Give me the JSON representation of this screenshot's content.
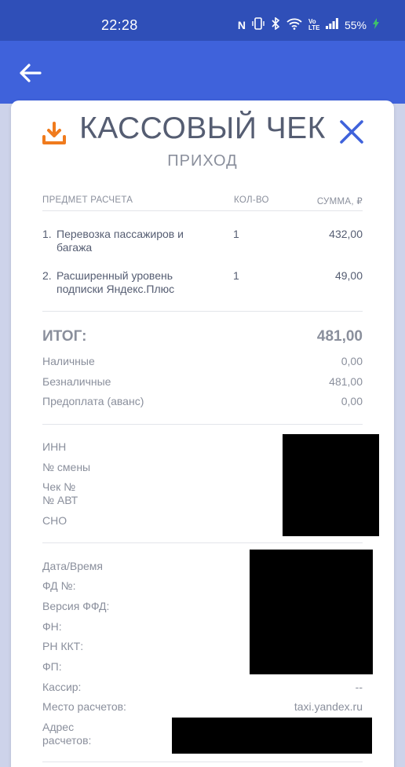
{
  "status_bar": {
    "time": "22:28",
    "battery": "55%",
    "network_label": "Vo LTE"
  },
  "receipt": {
    "title": "КАССОВЫЙ ЧЕК",
    "subtitle": "ПРИХОД",
    "columns": {
      "item": "ПРЕДМЕТ РАСЧЕТА",
      "qty": "КОЛ-ВО",
      "sum": "СУММА, ₽"
    },
    "items": [
      {
        "num": "1.",
        "name": "Перевозка пассажиров и багажа",
        "qty": "1",
        "sum": "432,00"
      },
      {
        "num": "2.",
        "name": "Расширенный уровень подписки Яндекс.Плюс",
        "qty": "1",
        "sum": "49,00"
      }
    ],
    "total": {
      "label": "ИТОГ:",
      "value": "481,00"
    },
    "payments": [
      {
        "label": "Наличные",
        "value": "0,00"
      },
      {
        "label": "Безналичные",
        "value": "481,00"
      },
      {
        "label": "Предоплата (аванс)",
        "value": "0,00"
      }
    ],
    "registration": {
      "inn": "ИНН",
      "shift": "№ смены",
      "check_no": "Чек №",
      "avt_no": "№ АВТ",
      "sno": "СНО"
    },
    "fiscal": {
      "datetime": "Дата/Время",
      "fd": "ФД №:",
      "ffd_version": "Версия ФФД:",
      "fn": "ФН:",
      "rn_kkt": "РН ККТ:",
      "fp": "ФП:",
      "cashier": "Кассир:",
      "cashier_value": "--",
      "place": "Место расчетов:",
      "place_value": "taxi.yandex.ru",
      "address_line1": "Адрес",
      "address_line2": "расчетов:"
    }
  },
  "colors": {
    "status_bar": "#2f4fb8",
    "app_bar": "#3f62db",
    "accent_download": "#f07b1d",
    "accent_close": "#3f62db",
    "background": "#cdd3ea"
  },
  "icons": {
    "back": "arrow-left-icon",
    "download": "download-icon",
    "close": "close-icon"
  }
}
